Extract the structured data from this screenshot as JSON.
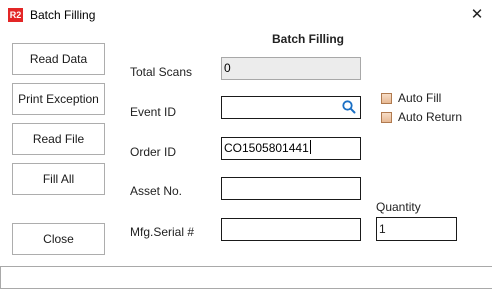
{
  "window": {
    "icon_text": "R2",
    "title": "Batch Filling",
    "close_glyph": "✕"
  },
  "buttons": {
    "read_data": "Read Data",
    "print_exception": "Print Exception",
    "read_file": "Read File",
    "fill_all": "Fill All",
    "close": "Close"
  },
  "form": {
    "section_title": "Batch Filling",
    "total_scans": {
      "label": "Total Scans",
      "value": "0"
    },
    "event_id": {
      "label": "Event ID",
      "value": ""
    },
    "order_id": {
      "label": "Order ID",
      "value": "CO1505801441"
    },
    "asset_no": {
      "label": "Asset No.",
      "value": ""
    },
    "mfg_serial": {
      "label": "Mfg.Serial #",
      "value": ""
    }
  },
  "options": {
    "auto_fill": {
      "label": "Auto Fill",
      "checked": false
    },
    "auto_return": {
      "label": "Auto Return",
      "checked": false
    }
  },
  "quantity": {
    "label": "Quantity",
    "value": "1"
  },
  "status_bar": {
    "text": ""
  },
  "colors": {
    "app_icon_bg": "#e32626",
    "checkbox_fill": "#e7b994",
    "readonly_bg": "#ececec",
    "search_icon": "#1a6fc4"
  }
}
